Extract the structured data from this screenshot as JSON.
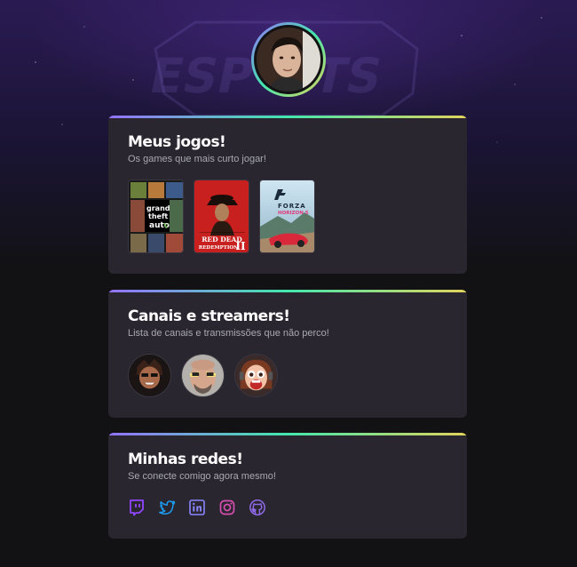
{
  "profile": {
    "avatar_alt": "Foto de perfil"
  },
  "games_card": {
    "title": "Meus jogos!",
    "subtitle": "Os games que mais curto jogar!",
    "games": [
      {
        "name": "Grand Theft Auto V",
        "icon": "gta-v-cover"
      },
      {
        "name": "Red Dead Redemption II",
        "icon": "rdr2-cover"
      },
      {
        "name": "Forza Horizon 5",
        "icon": "forza-horizon-5-cover"
      }
    ]
  },
  "channels_card": {
    "title": "Canais e streamers!",
    "subtitle": "Lista de canais e transmissões que não perco!",
    "channels": [
      {
        "icon": "streamer-avatar-1"
      },
      {
        "icon": "streamer-avatar-2"
      },
      {
        "icon": "streamer-avatar-3"
      }
    ]
  },
  "socials_card": {
    "title": "Minhas redes!",
    "subtitle": "Se conecte comigo agora mesmo!",
    "links": [
      {
        "icon": "twitch-icon",
        "color": "#9146ff"
      },
      {
        "icon": "twitter-icon",
        "color": "#1d9bf0"
      },
      {
        "icon": "linkedin-icon",
        "color": "#8a86ff"
      },
      {
        "icon": "instagram-icon",
        "color": "#d64fb0"
      },
      {
        "icon": "github-icon",
        "color": "#8f6ae8"
      }
    ]
  },
  "colors": {
    "background": "#121214",
    "card": "#29262f",
    "gradient_start": "#9572fc",
    "gradient_mid": "#43e7ad",
    "gradient_end": "#e2d45c"
  }
}
